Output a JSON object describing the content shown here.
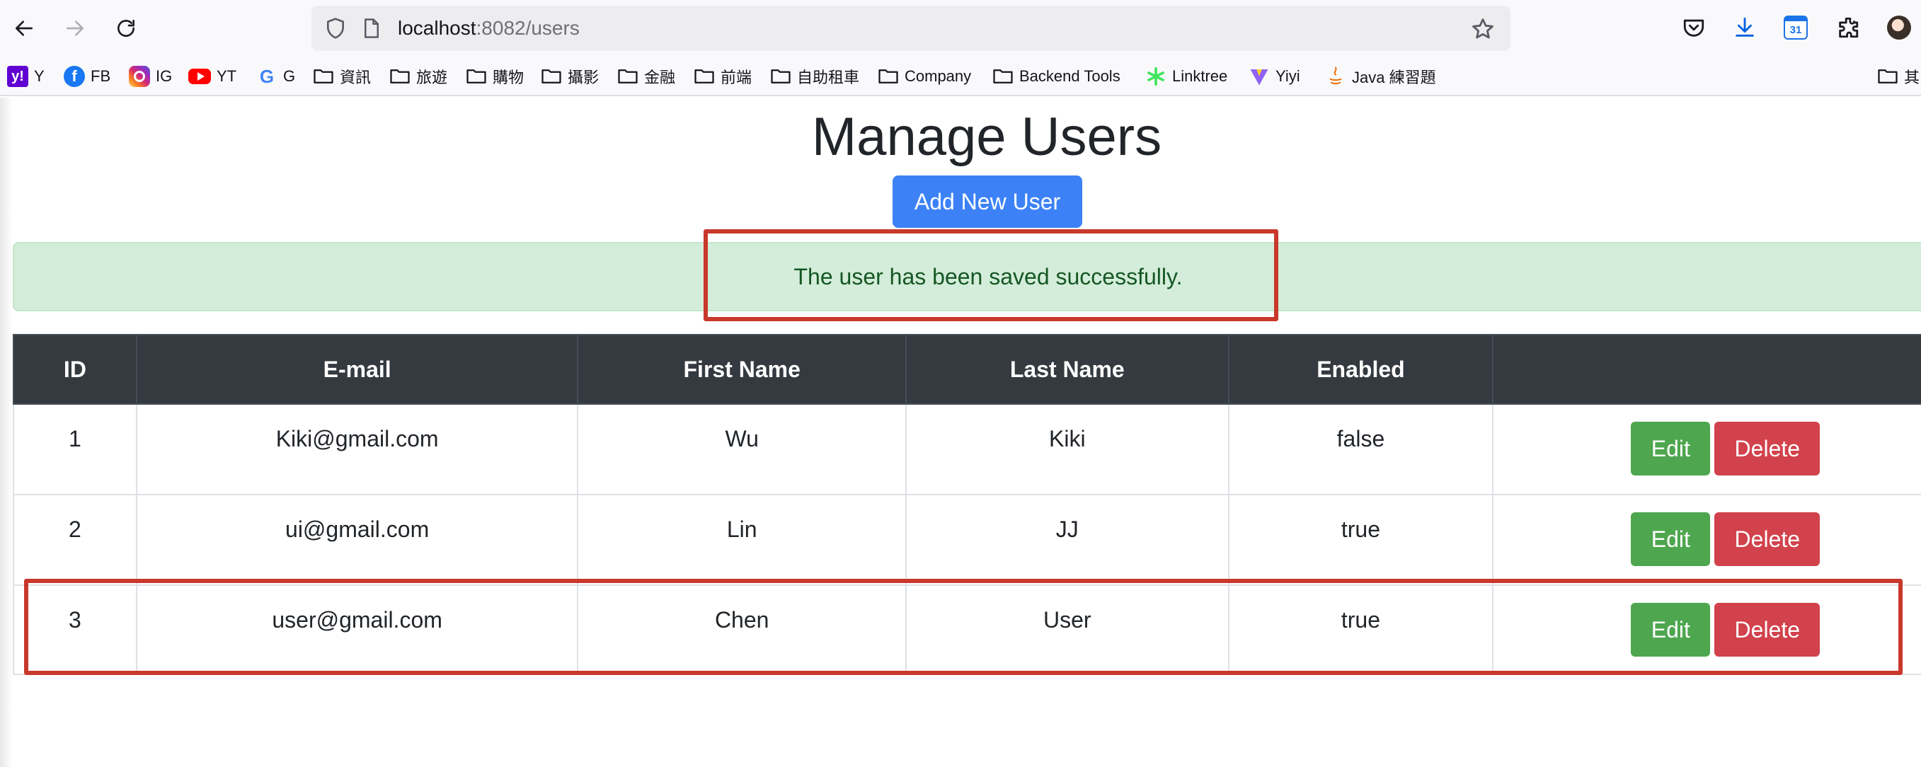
{
  "browser": {
    "url_host": "localhost",
    "url_path": ":8082/users",
    "bookmarks": [
      {
        "label": "Y",
        "icon": "yahoo-icon"
      },
      {
        "label": "FB",
        "icon": "facebook-icon"
      },
      {
        "label": "IG",
        "icon": "instagram-icon"
      },
      {
        "label": "YT",
        "icon": "youtube-icon"
      },
      {
        "label": "G",
        "icon": "google-icon"
      },
      {
        "label": "資訊",
        "icon": "folder-icon"
      },
      {
        "label": "旅遊",
        "icon": "folder-icon"
      },
      {
        "label": "購物",
        "icon": "folder-icon"
      },
      {
        "label": "攝影",
        "icon": "folder-icon"
      },
      {
        "label": "金融",
        "icon": "folder-icon"
      },
      {
        "label": "前端",
        "icon": "folder-icon"
      },
      {
        "label": "自助租車",
        "icon": "folder-icon"
      },
      {
        "label": "Company",
        "icon": "folder-icon"
      },
      {
        "label": "Backend Tools",
        "icon": "folder-icon"
      },
      {
        "label": "Linktree",
        "icon": "linktree-icon"
      },
      {
        "label": "Yiyi",
        "icon": "vite-icon"
      },
      {
        "label": "Java 練習題",
        "icon": "java-icon"
      },
      {
        "label": "其",
        "icon": "folder-icon"
      }
    ],
    "calendar_day": "31"
  },
  "page": {
    "title": "Manage Users",
    "add_button_label": "Add New User",
    "alert_message": "The user has been saved successfully."
  },
  "table": {
    "headers": [
      "ID",
      "E-mail",
      "First Name",
      "Last Name",
      "Enabled",
      ""
    ],
    "rows": [
      {
        "id": "1",
        "email": "Kiki@gmail.com",
        "first_name": "Wu",
        "last_name": "Kiki",
        "enabled": "false"
      },
      {
        "id": "2",
        "email": "ui@gmail.com",
        "first_name": "Lin",
        "last_name": "JJ",
        "enabled": "true"
      },
      {
        "id": "3",
        "email": "user@gmail.com",
        "first_name": "Chen",
        "last_name": "User",
        "enabled": "true"
      }
    ],
    "edit_label": "Edit",
    "delete_label": "Delete"
  },
  "colors": {
    "primary": "#3c82f6",
    "success_bg": "#d4edda",
    "success_text": "#155724",
    "table_header": "#343a40",
    "edit": "#4ea64f",
    "delete": "#d2424c",
    "highlight": "#c8382b"
  }
}
